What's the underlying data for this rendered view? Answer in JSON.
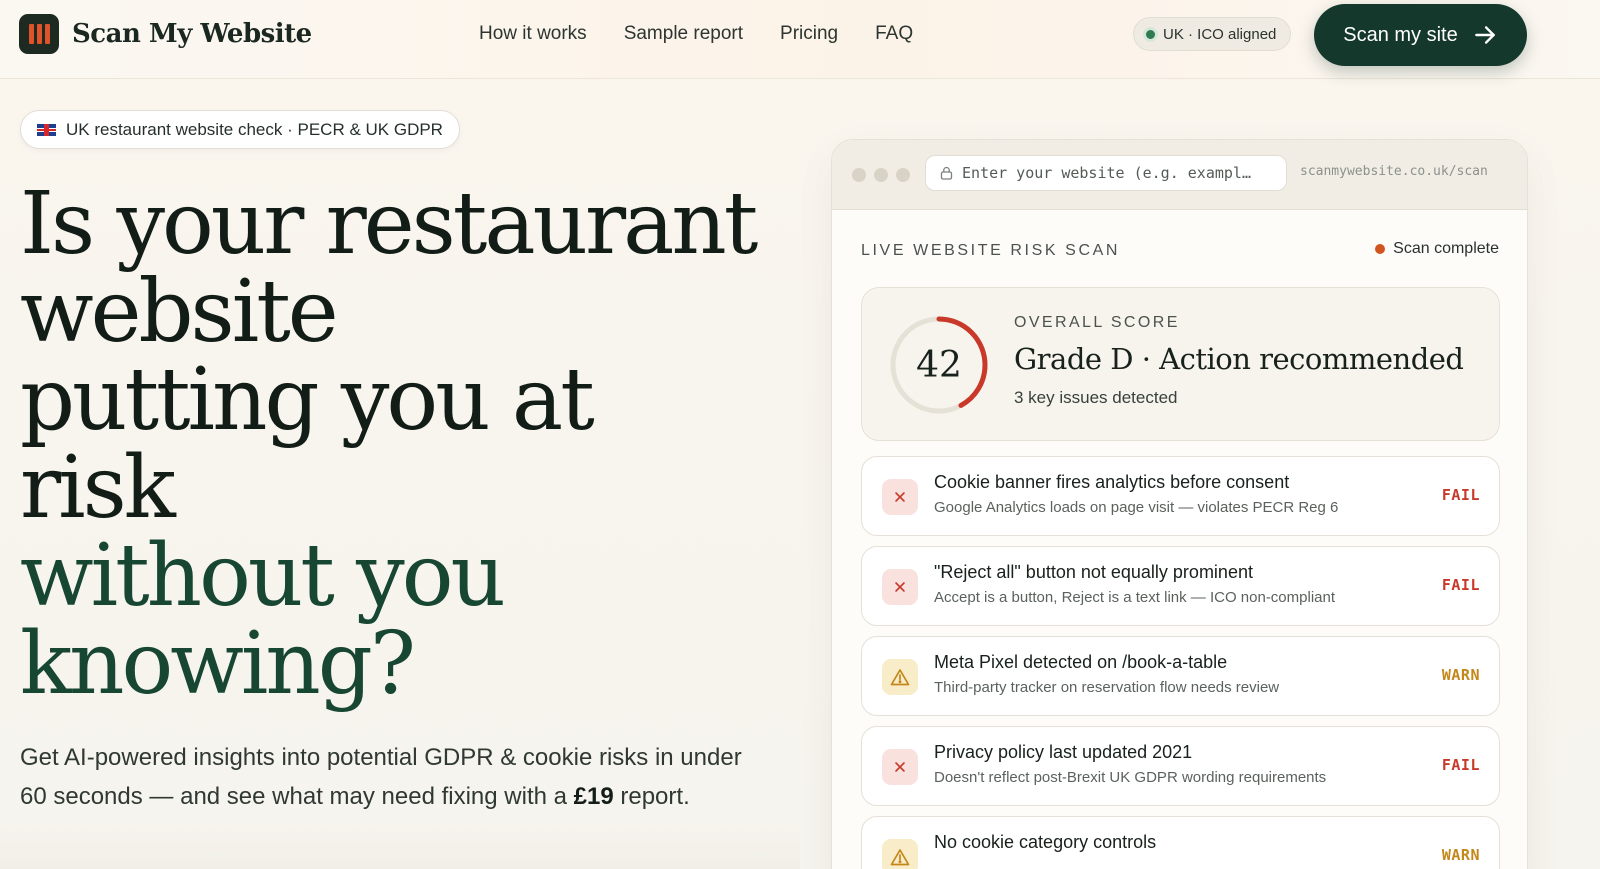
{
  "header": {
    "brand": "Scan My Website",
    "nav": [
      "How it works",
      "Sample report",
      "Pricing",
      "FAQ"
    ],
    "ico_badge": "UK · ICO aligned",
    "cta_label": "Scan my site"
  },
  "hero": {
    "pill": "UK restaurant website check · PECR & UK GDPR",
    "headline_lines": [
      "Is your restaurant",
      "website",
      "putting you at",
      "risk"
    ],
    "headline_accent_lines": [
      "without you",
      "knowing?"
    ],
    "sub_pre": "Get AI-powered insights into potential GDPR & cookie risks in under 60 seconds — and see what may need fixing with a ",
    "sub_price": "£19",
    "sub_post": " report."
  },
  "scan": {
    "url_placeholder": "Enter your website (e.g. exampl…",
    "url_right": "scanmywebsite.co.uk/scan",
    "heading": "LIVE WEBSITE RISK SCAN",
    "status": "Scan complete",
    "score": {
      "value": "42",
      "fraction": 0.42,
      "label": "OVERALL SCORE",
      "grade": "Grade D · Action recommended",
      "summary": "3 key issues detected"
    },
    "issues": [
      {
        "title": "Cookie banner fires analytics before consent",
        "desc": "Google Analytics loads on page visit — violates PECR Reg 6",
        "status": "FAIL",
        "kind": "fail"
      },
      {
        "title": "\"Reject all\" button not equally prominent",
        "desc": "Accept is a button, Reject is a text link — ICO non-compliant",
        "status": "FAIL",
        "kind": "fail"
      },
      {
        "title": "Meta Pixel detected on /book-a-table",
        "desc": "Third-party tracker on reservation flow needs review",
        "status": "WARN",
        "kind": "warn"
      },
      {
        "title": "Privacy policy last updated 2021",
        "desc": "Doesn't reflect post-Brexit UK GDPR wording requirements",
        "status": "FAIL",
        "kind": "fail"
      },
      {
        "title": "No cookie category controls",
        "desc": "",
        "status": "WARN",
        "kind": "warn"
      }
    ]
  },
  "colors": {
    "brand_dark": "#15382c",
    "accent_orange": "#e0532a",
    "fail": "#c73a2b",
    "warn": "#c3871a",
    "gauge_arc": "#c9392a"
  }
}
